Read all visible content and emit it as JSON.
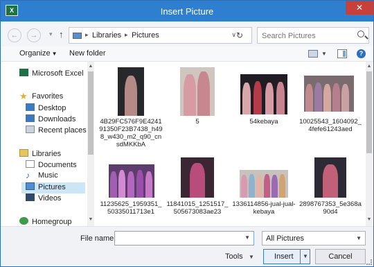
{
  "window": {
    "title": "Insert Picture",
    "app_icon_text": "X",
    "close_glyph": "✕"
  },
  "nav": {
    "back_glyph": "←",
    "forward_glyph": "→",
    "recent_glyph": "▾",
    "up_glyph": "↑",
    "breadcrumb": [
      "Libraries",
      "Pictures"
    ],
    "breadcrumb_sep": "▸",
    "address_dropdown_glyph": "∨",
    "refresh_glyph": "↻",
    "search_placeholder": "Search Pictures"
  },
  "toolbar": {
    "organize_label": "Organize",
    "dropdown_glyph": "▼",
    "new_folder_label": "New folder",
    "help_glyph": "?"
  },
  "sidebar": {
    "items": [
      {
        "label": "Microsoft Excel",
        "icon": "excel-icon"
      },
      {
        "label": "Favorites",
        "icon": "star-icon"
      },
      {
        "label": "Desktop",
        "icon": "desktop-icon"
      },
      {
        "label": "Downloads",
        "icon": "downloads-icon"
      },
      {
        "label": "Recent places",
        "icon": "recent-places-icon"
      },
      {
        "label": "Libraries",
        "icon": "libraries-icon"
      },
      {
        "label": "Documents",
        "icon": "documents-icon"
      },
      {
        "label": "Music",
        "icon": "music-icon"
      },
      {
        "label": "Pictures",
        "icon": "pictures-icon",
        "selected": true
      },
      {
        "label": "Videos",
        "icon": "videos-icon"
      },
      {
        "label": "Homegroup",
        "icon": "homegroup-icon"
      }
    ],
    "star_glyph": "★",
    "music_glyph": "♪",
    "scroll_up_glyph": "▲",
    "scroll_down_glyph": "▼"
  },
  "files": [
    {
      "name": "4B29FC576F9E424191350F23B7438_h498_w430_m2_q90_cnsdMKKbA"
    },
    {
      "name": "5"
    },
    {
      "name": "54kebaya"
    },
    {
      "name": "10025543_1604092_4fefe61243aed"
    },
    {
      "name": "11235625_1959351_50335011713e1"
    },
    {
      "name": "11841015_1251517_505673083ae23"
    },
    {
      "name": "1336114856-jual-jual-kebaya"
    },
    {
      "name": "2898767353_5e368a90d4"
    }
  ],
  "footer": {
    "file_name_label": "File name:",
    "file_name_value": "",
    "filter_value": "All Pictures",
    "tools_label": "Tools",
    "insert_label": "Insert",
    "cancel_label": "Cancel",
    "dropdown_glyph": "▼"
  }
}
